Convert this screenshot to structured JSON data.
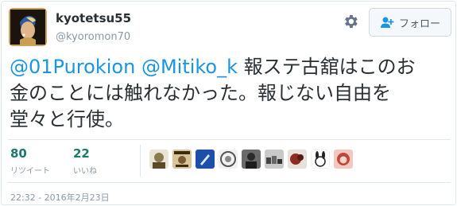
{
  "user": {
    "display_name": "kyotetsu55",
    "screen_name": "@kyoromon70",
    "avatar_icon": "pearl-earring-portrait-avatar"
  },
  "header": {
    "settings_icon": "gear-icon",
    "follow_label": "フォロー",
    "follow_icon": "person-plus-icon"
  },
  "tweet": {
    "mention_1": "@01Purokion",
    "mention_2": "@Mitiko_k",
    "text_1": " 報ステ古舘はこのお",
    "text_2": "金のことには触れなかった。報じない自由を",
    "text_3": "堂々と行使。"
  },
  "stats": {
    "retweets_count": "80",
    "retweets_label": "リツイート",
    "likes_count": "22",
    "likes_label": "いいね"
  },
  "liked_by_avatars": [
    "avatar-1",
    "avatar-2",
    "avatar-3",
    "avatar-4",
    "avatar-5",
    "avatar-6",
    "avatar-7",
    "avatar-8",
    "avatar-9"
  ],
  "timestamp": "22:32 - 2016年2月23日",
  "colors": {
    "mention": "#1b95e0",
    "count": "#1a7a6b",
    "muted": "#8899a6"
  }
}
